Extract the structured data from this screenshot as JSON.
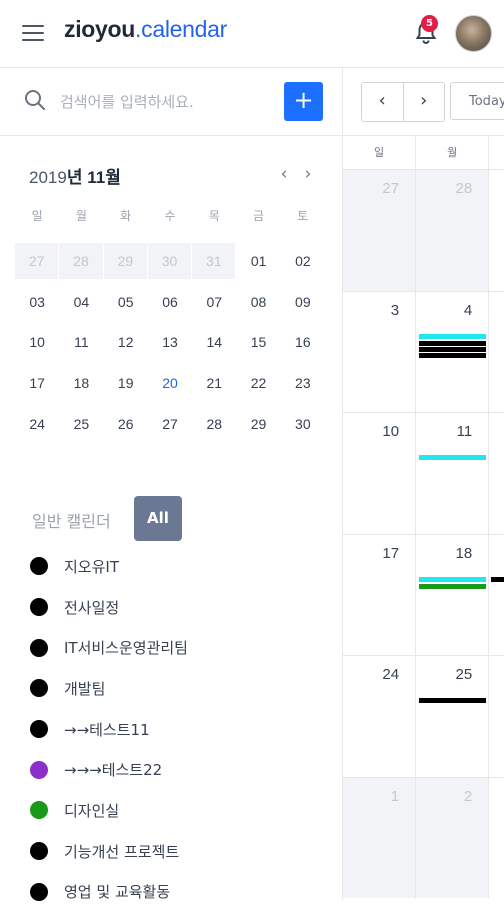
{
  "header": {
    "logo_bold": "zioyou",
    "logo_color": ".calendar",
    "notification_count": "5"
  },
  "search": {
    "placeholder": "검색어를 입력하세요.",
    "add_label": "+"
  },
  "mini_calendar": {
    "year": "2019",
    "year_suffix": "년",
    "month": "11",
    "month_suffix": "월",
    "prev_label": "‹",
    "next_label": "›",
    "weekdays": [
      "일",
      "월",
      "화",
      "수",
      "목",
      "금",
      "토"
    ],
    "weeks": [
      [
        "27",
        "28",
        "29",
        "30",
        "31",
        "01",
        "02"
      ],
      [
        "03",
        "04",
        "05",
        "06",
        "07",
        "08",
        "09"
      ],
      [
        "10",
        "11",
        "12",
        "13",
        "14",
        "15",
        "16"
      ],
      [
        "17",
        "18",
        "19",
        "20",
        "21",
        "22",
        "23"
      ],
      [
        "24",
        "25",
        "26",
        "27",
        "28",
        "29",
        "30"
      ]
    ],
    "today": "20"
  },
  "calendars": {
    "label": "일반 캘린더",
    "all_label": "All",
    "items": [
      {
        "name": "지오유IT",
        "color": "#000000"
      },
      {
        "name": "전사일정",
        "color": "#000000"
      },
      {
        "name": "IT서비스운영관리팀",
        "color": "#000000"
      },
      {
        "name": "개발팀",
        "color": "#000000"
      },
      {
        "name": "→→테스트11",
        "color": "#000000"
      },
      {
        "name": "→→→테스트22",
        "color": "#8b2fc9"
      },
      {
        "name": "디자인실",
        "color": "#1a9a1a"
      },
      {
        "name": "기능개선 프로젝트",
        "color": "#000000"
      },
      {
        "name": "영업 및 교육활동",
        "color": "#000000"
      }
    ]
  },
  "main": {
    "prev_label": "‹",
    "next_label": "›",
    "today_label": "Today",
    "weekday_headers": [
      "일",
      "월",
      ""
    ],
    "weeks": [
      {
        "days": [
          "27",
          "28"
        ]
      },
      {
        "days": [
          "3",
          "4"
        ]
      },
      {
        "days": [
          "10",
          "11"
        ]
      },
      {
        "days": [
          "17",
          "18"
        ]
      },
      {
        "days": [
          "24",
          "25"
        ]
      },
      {
        "days": [
          "1",
          "2"
        ]
      }
    ]
  }
}
